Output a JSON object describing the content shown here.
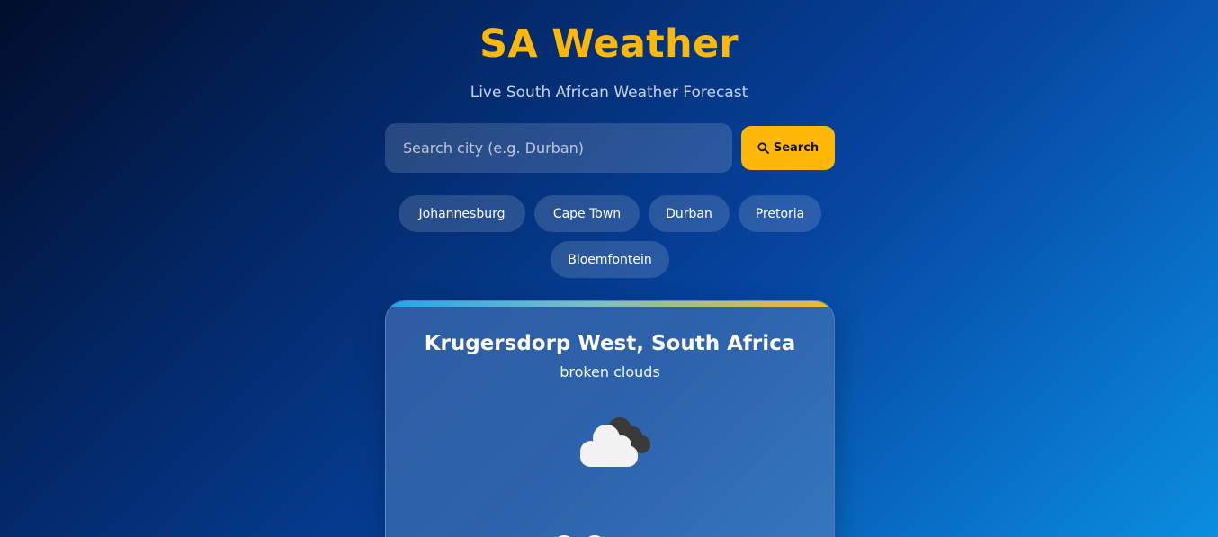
{
  "header": {
    "title": "SA Weather",
    "subtitle": "Live South African Weather Forecast"
  },
  "search": {
    "placeholder": "Search city (e.g. Durban)",
    "value": "",
    "button_label": "Search",
    "button_icon": "search-icon"
  },
  "quick_cities": [
    {
      "label": "Johannesburg"
    },
    {
      "label": "Cape Town"
    },
    {
      "label": "Durban"
    },
    {
      "label": "Pretoria"
    },
    {
      "label": "Bloemfontein"
    }
  ],
  "weather_card": {
    "location": "Krugersdorp West, South Africa",
    "description": "broken clouds",
    "icon": "broken-clouds-icon"
  },
  "colors": {
    "accent": "#ffb808",
    "gradient_start": "#1ea7ee",
    "gradient_end": "#f4b82b"
  }
}
